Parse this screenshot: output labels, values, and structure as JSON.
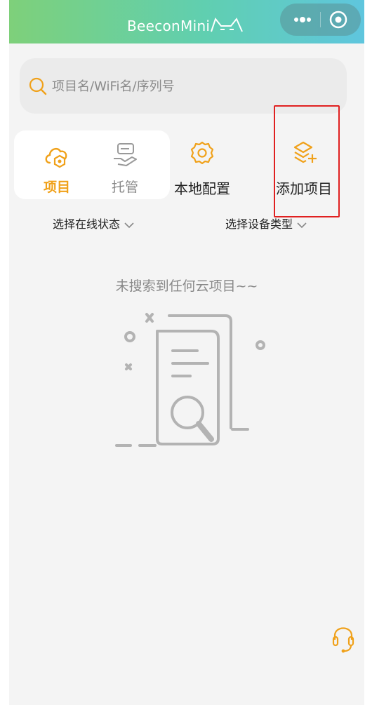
{
  "window": {
    "title": "BeeconMini",
    "more_icon": "more-dots-icon",
    "close_icon": "close-target-icon"
  },
  "search": {
    "placeholder": "项目名/WiFi名/序列号",
    "icon": "search-icon"
  },
  "tabs": [
    {
      "label": "项目",
      "icon": "cloud-project-icon",
      "active": true
    },
    {
      "label": "托管",
      "icon": "hosting-hand-icon",
      "active": false
    }
  ],
  "actions": [
    {
      "label": "本地配置",
      "icon": "gear-icon"
    },
    {
      "label": "添加项目",
      "icon": "add-layers-icon"
    }
  ],
  "filters": [
    {
      "label": "选择在线状态",
      "icon": "chevron-down-icon"
    },
    {
      "label": "选择设备类型",
      "icon": "chevron-down-icon"
    }
  ],
  "empty_state": {
    "message": "未搜索到任何云项目~~",
    "illustration": "empty-search-documents-illustration"
  },
  "support": {
    "icon": "headset-icon"
  },
  "colors": {
    "accent": "#f0a11a",
    "titlebar_start": "#7ed07a",
    "titlebar_end": "#5fc6de",
    "highlight": "#e02020",
    "background": "#f4f4f4"
  }
}
